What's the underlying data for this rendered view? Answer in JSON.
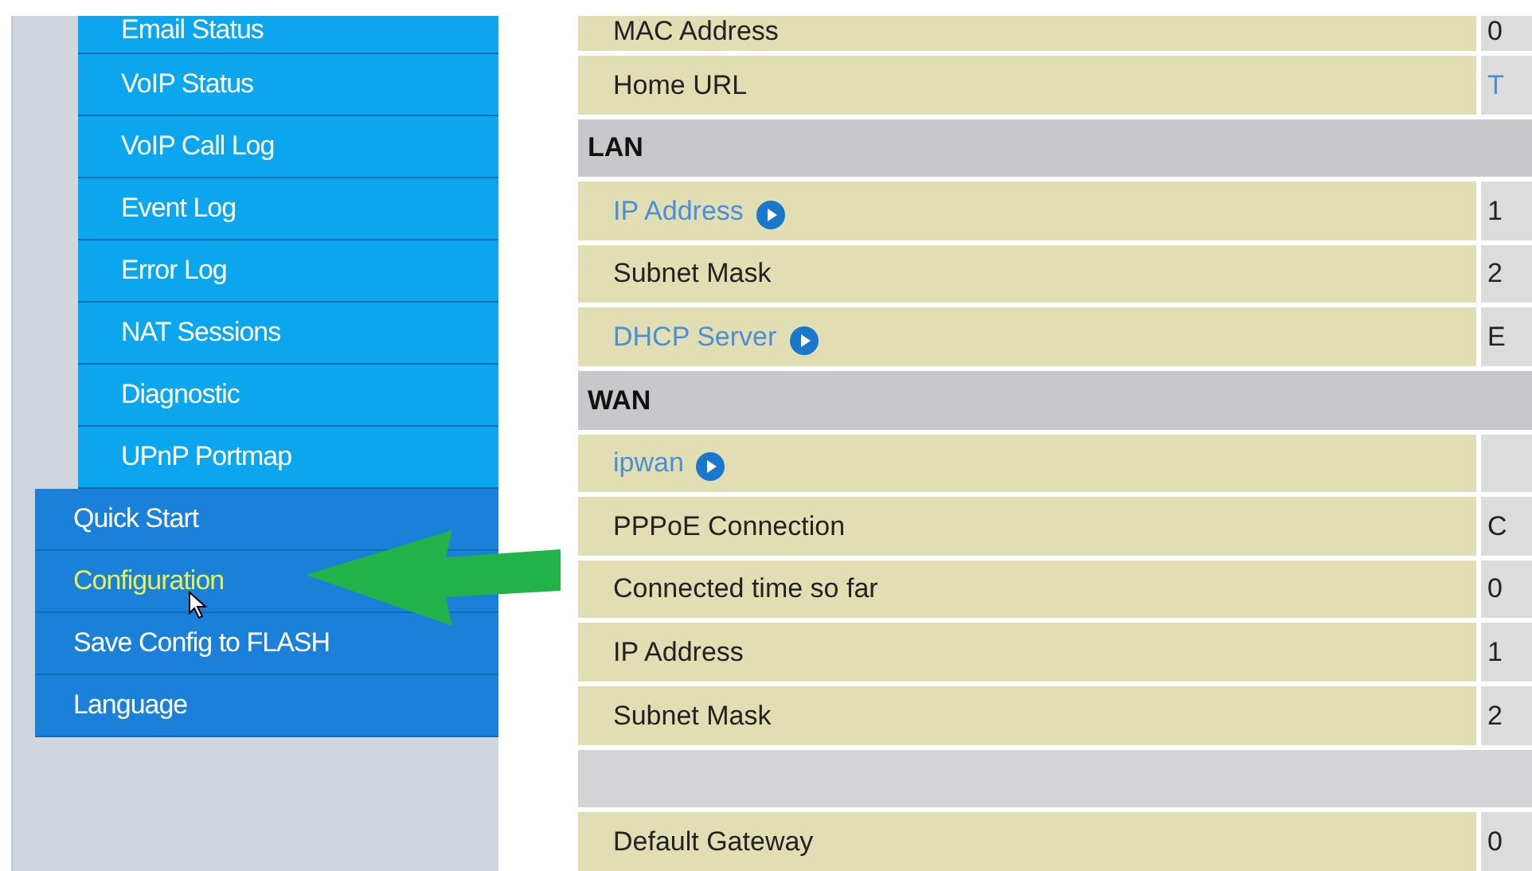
{
  "sidebar": {
    "items": [
      {
        "label": "Email Status",
        "kind": "sub",
        "selected": false
      },
      {
        "label": "VoIP Status",
        "kind": "sub",
        "selected": false
      },
      {
        "label": "VoIP Call Log",
        "kind": "sub",
        "selected": false
      },
      {
        "label": "Event Log",
        "kind": "sub",
        "selected": false
      },
      {
        "label": "Error Log",
        "kind": "sub",
        "selected": false
      },
      {
        "label": "NAT Sessions",
        "kind": "sub",
        "selected": false
      },
      {
        "label": "Diagnostic",
        "kind": "sub",
        "selected": false
      },
      {
        "label": "UPnP Portmap",
        "kind": "sub",
        "selected": false
      },
      {
        "label": "Quick Start",
        "kind": "main",
        "selected": false
      },
      {
        "label": "Configuration",
        "kind": "main",
        "selected": true
      },
      {
        "label": "Save Config to FLASH",
        "kind": "main",
        "selected": false
      },
      {
        "label": "Language",
        "kind": "main",
        "selected": false
      }
    ]
  },
  "table": {
    "rows": [
      {
        "kind": "row",
        "label": "MAC Address",
        "link": false,
        "value": "0",
        "value_link": false
      },
      {
        "kind": "row",
        "label": "Home URL",
        "link": false,
        "value": "T",
        "value_link": true
      },
      {
        "kind": "header",
        "label": "LAN"
      },
      {
        "kind": "row",
        "label": "IP Address",
        "link": true,
        "value": "1",
        "value_link": false
      },
      {
        "kind": "row",
        "label": "Subnet Mask",
        "link": false,
        "value": "2",
        "value_link": false
      },
      {
        "kind": "row",
        "label": "DHCP Server",
        "link": true,
        "value": "E",
        "value_link": false
      },
      {
        "kind": "header",
        "label": "WAN"
      },
      {
        "kind": "row",
        "label": "ipwan",
        "link": true,
        "value_link": false
      },
      {
        "kind": "row",
        "label": "PPPoE Connection",
        "link": false,
        "value": "C",
        "value_link": false
      },
      {
        "kind": "row",
        "label": "Connected time so far",
        "link": false,
        "value": "0",
        "value_link": false
      },
      {
        "kind": "row",
        "label": "IP Address",
        "link": false,
        "value": "1",
        "value_link": false
      },
      {
        "kind": "row",
        "label": "Subnet Mask",
        "link": false,
        "value": "2",
        "value_link": false
      },
      {
        "kind": "blank"
      },
      {
        "kind": "row",
        "label": "Default Gateway",
        "link": false,
        "value": "0",
        "value_link": false
      }
    ]
  }
}
